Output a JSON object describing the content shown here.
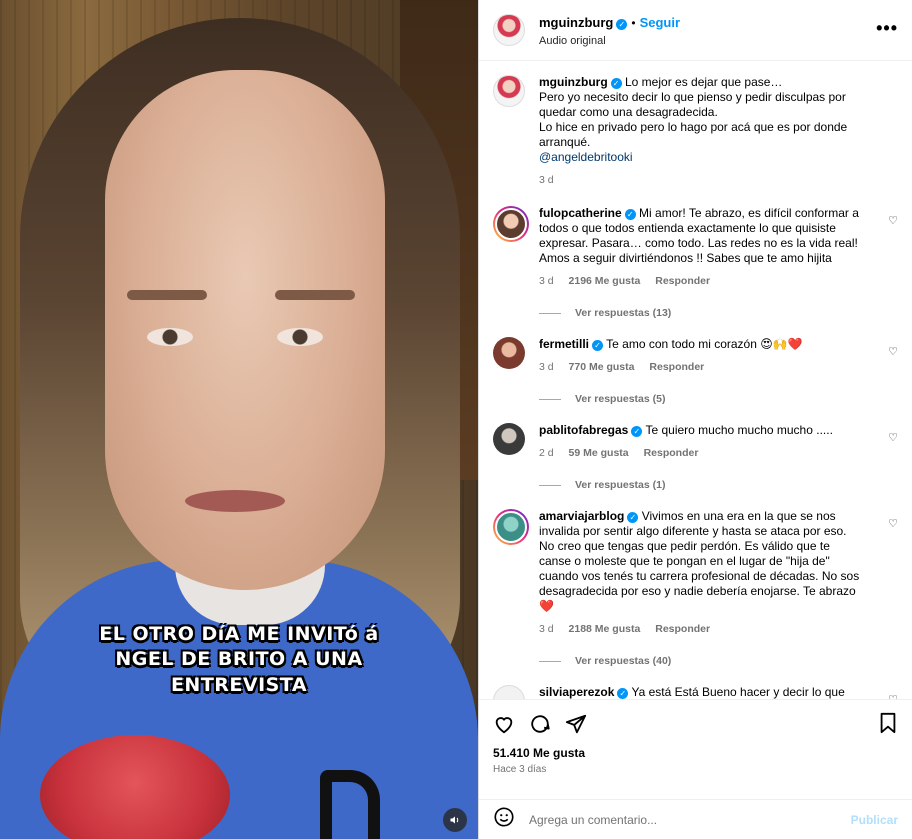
{
  "video": {
    "captions": [
      "EL OTRO DíA ME INVITó á",
      "NGEL DE BRITO A UNA",
      "ENTREVISTA"
    ],
    "mute_icon": "speaker-icon"
  },
  "header": {
    "username": "mguinzburg",
    "follow_label": "Seguir",
    "subtitle": "Audio original",
    "more_icon": "ellipsis-icon"
  },
  "post": {
    "username": "mguinzburg",
    "lines": [
      "Lo mejor es dejar que pase…",
      "Pero yo necesito decir lo que pienso y pedir disculpas por quedar como una desagradecida.",
      "Lo hice en privado pero lo hago por acá que es por donde arranqué."
    ],
    "mention": "@angeldebritooki",
    "time": "3 d"
  },
  "comments": [
    {
      "username": "fulopcatherine",
      "text": "Mi amor! Te abrazo, es difícil conformar a todos o que todos entienda exactamente lo que quisiste expresar. Pasara… como todo. Las redes no es la vida real! Amos a seguir divirtiéndonos !! Sabes que te amo hijita",
      "time": "3 d",
      "likes": "2196 Me gusta",
      "reply": "Responder",
      "replies": "Ver respuestas (13)"
    },
    {
      "username": "fermetilli",
      "text": "Te amo con todo mi corazón 😍🙌❤️",
      "time": "3 d",
      "likes": "770 Me gusta",
      "reply": "Responder",
      "replies": "Ver respuestas (5)"
    },
    {
      "username": "pablitofabregas",
      "text": "Te quiero mucho mucho mucho .....",
      "time": "2 d",
      "likes": "59 Me gusta",
      "reply": "Responder",
      "replies": "Ver respuestas (1)"
    },
    {
      "username": "amarviajarblog",
      "text": "Vivimos en una era en la que se nos invalida por sentir algo diferente y hasta se ataca por eso. No creo que tengas que pedir perdón. Es válido que te canse o moleste que te pongan en el lugar de \"hija de\" cuando vos tenés tu carrera profesional de décadas. No sos desagradecida por eso y nadie debería enojarse. Te abrazo ❤️",
      "time": "3 d",
      "likes": "2188 Me gusta",
      "reply": "Responder",
      "replies": "Ver respuestas (40)"
    },
    {
      "username": "silviaperezok",
      "text": "Ya está Está Bueno hacer y decir lo que"
    }
  ],
  "actions": {
    "likes": "51.410 Me gusta",
    "ago": "Hace 3 días"
  },
  "comment_box": {
    "placeholder": "Agrega un comentario...",
    "publish_label": "Publicar"
  },
  "colors": {
    "accent": "#0095f6",
    "verified": "#0095f6",
    "publish_disabled": "#b2dffc"
  }
}
